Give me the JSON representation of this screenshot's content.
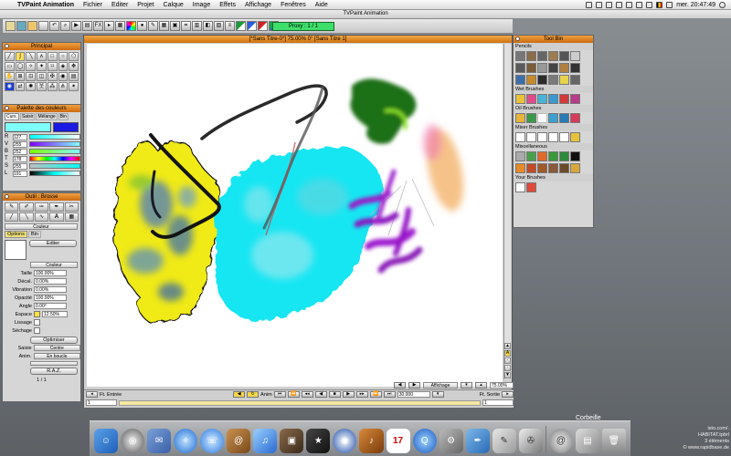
{
  "menubar": {
    "app": "TVPaint Animation",
    "items": [
      "Fichier",
      "Editer",
      "Projet",
      "Calque",
      "Image",
      "Effets",
      "Affichage",
      "Fenêtres",
      "Aide"
    ],
    "clock": "mer. 20:47:49"
  },
  "app_title": "TVPaint Animation",
  "toolbar": {
    "proxy": "Proxy : 1 / 1"
  },
  "principal": {
    "title": "Principal"
  },
  "palette": {
    "title": "Palette des couleurs",
    "tabs": [
      "Curs.",
      "Saisir",
      "Mélange",
      "Bin"
    ],
    "rows": [
      {
        "label": "R",
        "value": "127"
      },
      {
        "label": "V",
        "value": "255"
      },
      {
        "label": "B",
        "value": "252"
      },
      {
        "label": "T",
        "value": "178"
      },
      {
        "label": "S",
        "value": "255"
      },
      {
        "label": "L",
        "value": "191"
      }
    ]
  },
  "brush": {
    "title": "Outil : Brosse",
    "couleur": "Couleur",
    "tabs": [
      "Options",
      "Bin"
    ],
    "editer": "Editer",
    "mode": "Couleur",
    "params": [
      {
        "label": "Taille",
        "value": "100.00%"
      },
      {
        "label": "Décal.",
        "value": "0.00%"
      },
      {
        "label": "Vibration",
        "value": "0.00%"
      },
      {
        "label": "Opacité",
        "value": "100.00%"
      },
      {
        "label": "Angle",
        "value": "0.00°"
      },
      {
        "label": "Espace",
        "value": "12.50%"
      }
    ],
    "lissage": "Lissage",
    "sechage": "Séchage",
    "optimiser": "Optimiser",
    "saisie_label": "Saisie",
    "saisie_value": "Centre",
    "anim_label": "Anim.",
    "anim_value": "En boucle",
    "raz": "R.A.Z.",
    "page": "1 / 1"
  },
  "canvas": {
    "title": "[*Sans Titre-0*]  75.00%  0°  [Sans Titre 1]",
    "affichage": "Affichage",
    "zoom": "75.00%",
    "ft_entree": "Ft. Entrée",
    "ft_sortie": "Ft. Sortie",
    "frame_in": "1",
    "frame_out": "1",
    "anim": "Anim",
    "fps": "30.000"
  },
  "toolbin": {
    "title": "Tool Bin",
    "sections": [
      "Pencils",
      "Wet Brushes",
      "Oil Brushes",
      "Mixer Brushes",
      "Miscellaneous",
      "Your Brushes"
    ]
  },
  "dock": {
    "trash_label": "Corbeille"
  },
  "clipping": {
    "line1": "HABITAT.tpbrl",
    "line2": "3 éléments",
    "watermark": "© www.rapidbase.de",
    "partial": "isto.com/."
  }
}
